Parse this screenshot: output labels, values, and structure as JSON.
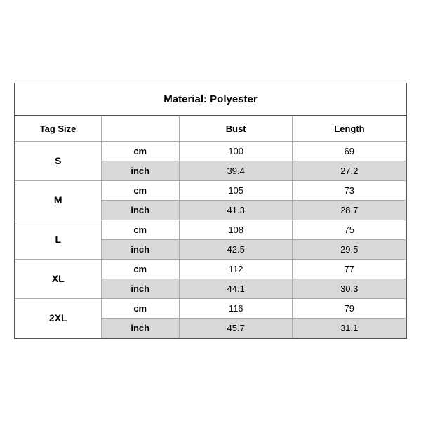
{
  "title": "Material: Polyester",
  "columns": {
    "tag_size": "Tag Size",
    "bust": "Bust",
    "length": "Length"
  },
  "sizes": [
    {
      "tag": "S",
      "cm_bust": "100",
      "cm_length": "69",
      "inch_bust": "39.4",
      "inch_length": "27.2"
    },
    {
      "tag": "M",
      "cm_bust": "105",
      "cm_length": "73",
      "inch_bust": "41.3",
      "inch_length": "28.7"
    },
    {
      "tag": "L",
      "cm_bust": "108",
      "cm_length": "75",
      "inch_bust": "42.5",
      "inch_length": "29.5"
    },
    {
      "tag": "XL",
      "cm_bust": "112",
      "cm_length": "77",
      "inch_bust": "44.1",
      "inch_length": "30.3"
    },
    {
      "tag": "2XL",
      "cm_bust": "116",
      "cm_length": "79",
      "inch_bust": "45.7",
      "inch_length": "31.1"
    }
  ],
  "units": {
    "cm": "cm",
    "inch": "inch"
  }
}
